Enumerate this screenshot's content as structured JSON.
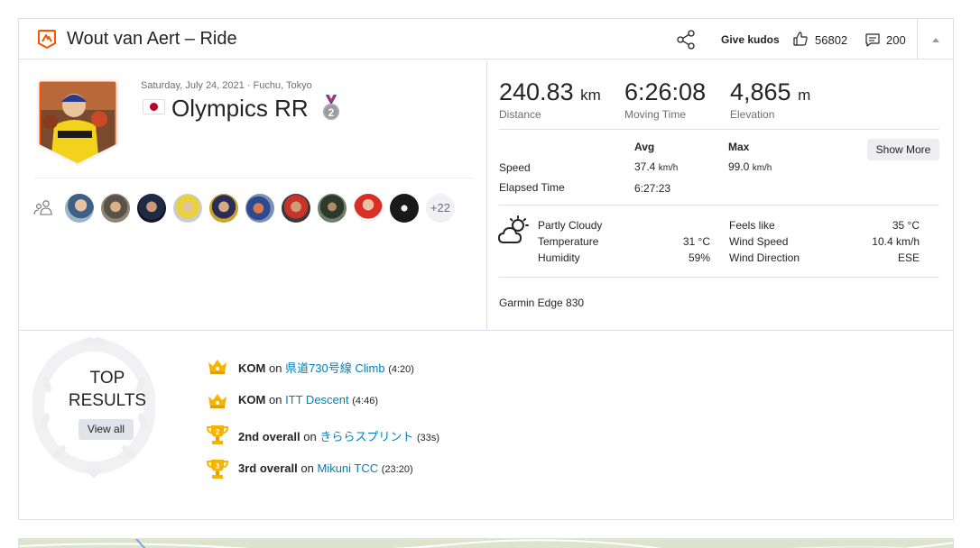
{
  "header": {
    "title": "Wout van Aert – Ride",
    "give_kudos": "Give kudos",
    "kudos_count": "56802",
    "comment_count": "200"
  },
  "activity": {
    "date_location": "Saturday, July 24, 2021 · Fuchu, Tokyo",
    "name": "Olympics RR",
    "medal_rank": "2",
    "more_athletes": "+22"
  },
  "stats": {
    "distance_value": "240.83",
    "distance_unit": "km",
    "distance_label": "Distance",
    "moving_time_value": "6:26:08",
    "moving_time_label": "Moving Time",
    "elevation_value": "4,865",
    "elevation_unit": "m",
    "elevation_label": "Elevation"
  },
  "more_stats": {
    "avg_header": "Avg",
    "max_header": "Max",
    "show_more": "Show More",
    "speed_label": "Speed",
    "speed_avg": "37.4",
    "speed_max": "99.0",
    "speed_unit": "km/h",
    "elapsed_label": "Elapsed Time",
    "elapsed_value": "6:27:23"
  },
  "weather": {
    "condition": "Partly Cloudy",
    "temperature_label": "Temperature",
    "temperature_value": "31 °C",
    "humidity_label": "Humidity",
    "humidity_value": "59%",
    "feels_like_label": "Feels like",
    "feels_like_value": "35 °C",
    "wind_speed_label": "Wind Speed",
    "wind_speed_value": "10.4 km/h",
    "wind_direction_label": "Wind Direction",
    "wind_direction_value": "ESE"
  },
  "device": "Garmin Edge 830",
  "top_results": {
    "title_line1": "TOP",
    "title_line2": "RESULTS",
    "view_all": "View all",
    "items": [
      {
        "icon": "crown-icon",
        "rank": "KOM",
        "on": "on",
        "segment": "県道730号線 Climb",
        "time": "(4:20)"
      },
      {
        "icon": "crown-icon",
        "rank": "KOM",
        "on": "on",
        "segment": "ITT Descent",
        "time": "(4:46)"
      },
      {
        "icon": "trophy-icon",
        "trophy_number": "2",
        "rank": "2nd overall",
        "on": "on",
        "segment": "きららスプリント",
        "time": "(33s)"
      },
      {
        "icon": "trophy-icon",
        "trophy_number": "3",
        "rank": "3rd overall",
        "on": "on",
        "segment": "Mikuni TCC",
        "time": "(23:20)"
      }
    ]
  },
  "colors": {
    "brand_orange": "#fc5200",
    "link_blue": "#007fb6",
    "gold": "#f5b400",
    "text": "#242428",
    "muted": "#6d6d78"
  }
}
